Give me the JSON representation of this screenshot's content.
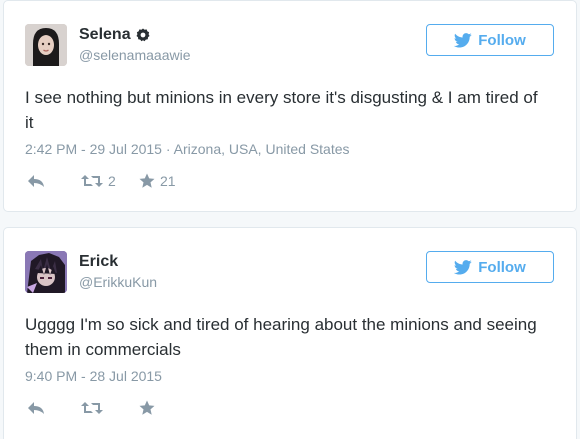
{
  "tweets": [
    {
      "display_name": "Selena",
      "handle": "@selenamaaawie",
      "verified": true,
      "follow_label": "Follow",
      "text": "I see nothing but minions in every store it's disgusting & I am tired of it",
      "meta": "2:42 PM - 29 Jul 2015 · Arizona, USA, United States",
      "retweets": "2",
      "likes": "21"
    },
    {
      "display_name": "Erick",
      "handle": "@ErikkuKun",
      "verified": false,
      "follow_label": "Follow",
      "text": "Ugggg I'm so sick and tired of hearing about the minions and seeing them in commercials",
      "meta": "9:40 PM - 28 Jul 2015",
      "retweets": "",
      "likes": ""
    }
  ],
  "colors": {
    "accent": "#55acee",
    "text": "#292f33",
    "muted": "#8899a6",
    "border": "#e1e8ed"
  },
  "icons": {
    "follow": "bird-icon",
    "verified": "verified-badge-icon",
    "reply": "reply-icon",
    "retweet": "retweet-icon",
    "like": "star-icon"
  }
}
